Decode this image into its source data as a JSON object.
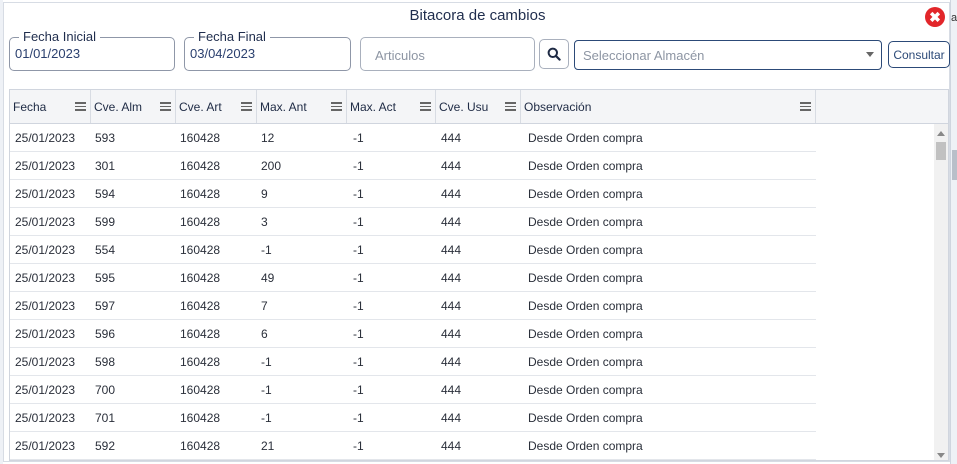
{
  "dialog": {
    "title": "Bitacora de cambios",
    "close_label": "✖"
  },
  "filters": {
    "fecha_inicial_label": "Fecha Inicial",
    "fecha_inicial_value": "01/01/2023",
    "fecha_final_label": "Fecha Final",
    "fecha_final_value": "03/04/2023",
    "articulos_placeholder": "Articulos",
    "almacen_placeholder": "Seleccionar Almacén",
    "consultar_label": "Consultar"
  },
  "grid": {
    "columns": [
      "Fecha",
      "Cve. Alm",
      "Cve. Art",
      "Max. Ant",
      "Max. Act",
      "Cve. Usu",
      "Observación"
    ],
    "rows": [
      [
        "25/01/2023",
        "593",
        "160428",
        "12",
        "-1",
        "444",
        "Desde Orden compra"
      ],
      [
        "25/01/2023",
        "301",
        "160428",
        "200",
        "-1",
        "444",
        "Desde Orden compra"
      ],
      [
        "25/01/2023",
        "594",
        "160428",
        "9",
        "-1",
        "444",
        "Desde Orden compra"
      ],
      [
        "25/01/2023",
        "599",
        "160428",
        "3",
        "-1",
        "444",
        "Desde Orden compra"
      ],
      [
        "25/01/2023",
        "554",
        "160428",
        "-1",
        "-1",
        "444",
        "Desde Orden compra"
      ],
      [
        "25/01/2023",
        "595",
        "160428",
        "49",
        "-1",
        "444",
        "Desde Orden compra"
      ],
      [
        "25/01/2023",
        "597",
        "160428",
        "7",
        "-1",
        "444",
        "Desde Orden compra"
      ],
      [
        "25/01/2023",
        "596",
        "160428",
        "6",
        "-1",
        "444",
        "Desde Orden compra"
      ],
      [
        "25/01/2023",
        "598",
        "160428",
        "-1",
        "-1",
        "444",
        "Desde Orden compra"
      ],
      [
        "25/01/2023",
        "700",
        "160428",
        "-1",
        "-1",
        "444",
        "Desde Orden compra"
      ],
      [
        "25/01/2023",
        "701",
        "160428",
        "-1",
        "-1",
        "444",
        "Desde Orden compra"
      ],
      [
        "25/01/2023",
        "592",
        "160428",
        "21",
        "-1",
        "444",
        "Desde Orden compra"
      ]
    ]
  },
  "background": {
    "right_edge_letter": "al"
  },
  "colors": {
    "accent": "#2c4a78",
    "close": "#e2262a",
    "header_bg": "#f4f5f7"
  }
}
